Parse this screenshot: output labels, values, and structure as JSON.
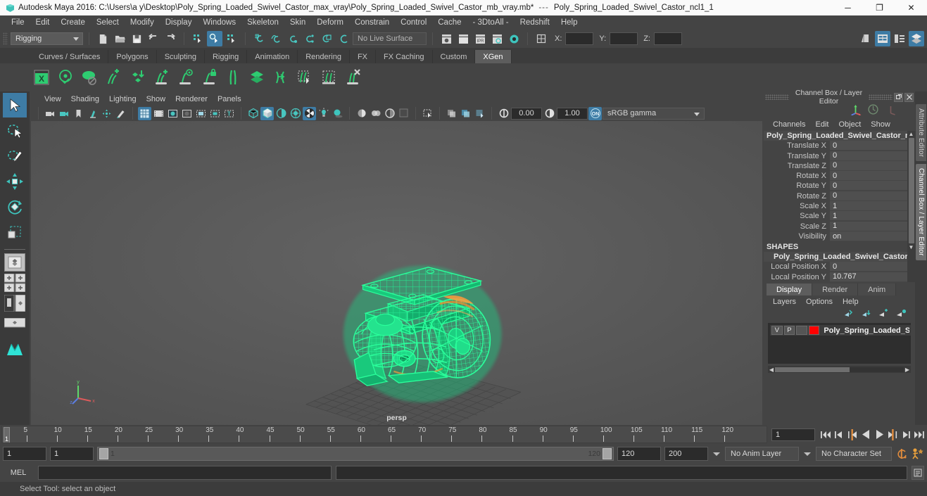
{
  "titlebar": {
    "app_title": "Autodesk Maya 2016: C:\\Users\\a y\\Desktop\\Poly_Spring_Loaded_Swivel_Castor_max_vray\\Poly_Spring_Loaded_Swivel_Castor_mb_vray.mb*",
    "separator": "---",
    "node_name": "Poly_Spring_Loaded_Swivel_Castor_ncl1_1",
    "minimize": "─",
    "maximize": "❐",
    "close": "✕"
  },
  "menubar": {
    "items": [
      "File",
      "Edit",
      "Create",
      "Select",
      "Modify",
      "Display",
      "Windows",
      "Skeleton",
      "Skin",
      "Deform",
      "Constrain",
      "Control",
      "Cache",
      "- 3DtoAll -",
      "Redshift",
      "Help"
    ]
  },
  "statusline": {
    "menu_set": "Rigging",
    "live_surface": "No Live Surface",
    "coord_labels": [
      "X:",
      "Y:",
      "Z:"
    ],
    "coord_values": [
      "",
      "",
      ""
    ],
    "icons": [
      "new-scene-icon",
      "open-scene-icon",
      "save-scene-icon",
      "undo-icon",
      "redo-icon",
      "select-by-hierarchy-icon",
      "select-by-object-icon",
      "select-by-component-icon",
      "snap-to-grid-icon",
      "snap-to-curve-icon",
      "snap-to-point-icon",
      "snap-to-projected-center-icon",
      "snap-to-view-plane-icon",
      "make-live-icon",
      "render-current-frame-icon",
      "render-sequence-icon",
      "ipr-render-icon",
      "render-settings-icon",
      "hypershade-icon",
      "input-output-connections-icon",
      "show-hide-modeling-toolkit-icon",
      "show-hide-attribute-editor-icon",
      "show-hide-tool-settings-icon",
      "show-hide-channel-box-icon"
    ]
  },
  "shelf": {
    "tabs": [
      "Curves / Surfaces",
      "Polygons",
      "Sculpting",
      "Rigging",
      "Animation",
      "Rendering",
      "FX",
      "FX Caching",
      "Custom",
      "XGen"
    ],
    "active_tab": "XGen",
    "icons": [
      "xgen-editor-icon",
      "xgen-preview-icon",
      "xgen-disable-preview-icon",
      "xgen-add-collection-icon",
      "xgen-import-archive-icon",
      "xgen-add-description-icon",
      "xgen-preview-description-icon",
      "xgen-lock-description-icon",
      "xgen-guides-icon",
      "xgen-layers-icon",
      "xgen-groom-convert-icon",
      "xgen-select-guides-icon",
      "xgen-bake-icon",
      "xgen-delete-icon"
    ]
  },
  "toolbox": {
    "tools": [
      "select-tool",
      "lasso-select-tool",
      "paint-select-tool",
      "move-tool",
      "rotate-tool",
      "scale-tool"
    ],
    "active_tool": "select-tool",
    "layouts": [
      "single-perspective-layout",
      "four-view-layout",
      "two-pane-side-layout",
      "two-pane-stacked-layout",
      "outliner-persp-layout"
    ]
  },
  "viewport": {
    "menus": [
      "View",
      "Shading",
      "Lighting",
      "Show",
      "Renderer",
      "Panels"
    ],
    "camera_label": "persp",
    "exposure_value": "0.00",
    "gamma_value": "1.00",
    "color_management": "sRGB gamma",
    "toolbar_icons": [
      "select-camera-icon",
      "camera-attributes-icon",
      "bookmark-icon",
      "image-plane-icon",
      "two-d-pan-zoom-icon",
      "grease-pencil-icon",
      "grid-toggle-icon",
      "film-gate-icon",
      "resolution-gate-icon",
      "gate-mask-icon",
      "field-chart-icon",
      "safe-action-icon",
      "safe-title-icon",
      "wireframe-icon",
      "smooth-shade-icon",
      "shade-with-wireframe-icon",
      "use-default-material-icon",
      "texture-mode-icon",
      "use-all-lights-icon",
      "shadows-icon",
      "screen-space-ao-icon",
      "motion-blur-icon",
      "multisample-aa-icon",
      "depth-peeling-icon",
      "isolate-select-icon",
      "xray-icon",
      "xray-joints-icon",
      "xray-active-components-icon",
      "exposure-icon",
      "gamma-icon",
      "color-management-toggle-icon"
    ],
    "axis_gizmo": "axis-triad-gizmo"
  },
  "channel_box": {
    "panel_title": "Channel Box / Layer Editor",
    "menus": [
      "Channels",
      "Edit",
      "Object",
      "Show"
    ],
    "object_name": "Poly_Spring_Loaded_Swivel_Castor_n...",
    "attributes": [
      {
        "label": "Translate X",
        "value": "0"
      },
      {
        "label": "Translate Y",
        "value": "0"
      },
      {
        "label": "Translate Z",
        "value": "0"
      },
      {
        "label": "Rotate X",
        "value": "0"
      },
      {
        "label": "Rotate Y",
        "value": "0"
      },
      {
        "label": "Rotate Z",
        "value": "0"
      },
      {
        "label": "Scale X",
        "value": "1"
      },
      {
        "label": "Scale Y",
        "value": "1"
      },
      {
        "label": "Scale Z",
        "value": "1"
      },
      {
        "label": "Visibility",
        "value": "on"
      }
    ],
    "shapes_header": "SHAPES",
    "shape_name": "Poly_Spring_Loaded_Swivel_Castor_...",
    "shape_attributes": [
      {
        "label": "Local Position X",
        "value": "0"
      },
      {
        "label": "Local Position Y",
        "value": "10.767"
      }
    ],
    "dock_buttons": [
      "undock-icon",
      "close-icon"
    ],
    "header_icons": [
      "manipulator-icon",
      "no-manipulator-icon",
      "move-manip-icon"
    ]
  },
  "layer_editor": {
    "tabs": [
      "Display",
      "Render",
      "Anim"
    ],
    "active_tab": "Display",
    "menus": [
      "Layers",
      "Options",
      "Help"
    ],
    "action_icons": [
      "prev-layer-icon",
      "next-layer-icon",
      "new-layer-icon",
      "new-layer-from-selected-icon"
    ],
    "layers": [
      {
        "visibility": "V",
        "playback": "P",
        "type": "",
        "color": "#ff0000",
        "name": "Poly_Spring_Loaded_Swi"
      }
    ]
  },
  "side_tabs": {
    "items": [
      "Attribute Editor",
      "Channel Box / Layer Editor"
    ],
    "active": "Channel Box / Layer Editor"
  },
  "timeline": {
    "ticks": [
      5,
      10,
      15,
      20,
      25,
      30,
      35,
      40,
      45,
      50,
      55,
      60,
      65,
      70,
      75,
      80,
      85,
      90,
      95,
      100,
      105,
      110,
      115,
      120
    ],
    "current_frame": "1",
    "playback_field": "1",
    "playback_buttons": [
      "go-to-start-icon",
      "step-back-frame-icon",
      "step-back-key-icon",
      "play-backwards-icon",
      "play-forwards-icon",
      "step-forward-key-icon",
      "step-forward-frame-icon",
      "go-to-end-icon"
    ]
  },
  "range_slider": {
    "anim_start": "1",
    "range_start": "1",
    "bar_start": "1",
    "bar_end": "120",
    "range_end": "120",
    "anim_end": "200",
    "anim_layer": "No Anim Layer",
    "character_set": "No Character Set",
    "auto_key_icon": "auto-keyframe-icon",
    "anim_prefs_icon": "animation-preferences-icon"
  },
  "command_line": {
    "language": "MEL",
    "input_value": "",
    "output_value": "",
    "script_editor_icon": "script-editor-icon"
  },
  "help_line": {
    "text": "Select Tool: select an object"
  },
  "colors": {
    "accent_blue": "#3e7ca5",
    "wireframe_green": "#2aff9b",
    "layer_red": "#ff0000",
    "panel_bg": "#444444",
    "viewport_bg": "#5a5a5a"
  }
}
